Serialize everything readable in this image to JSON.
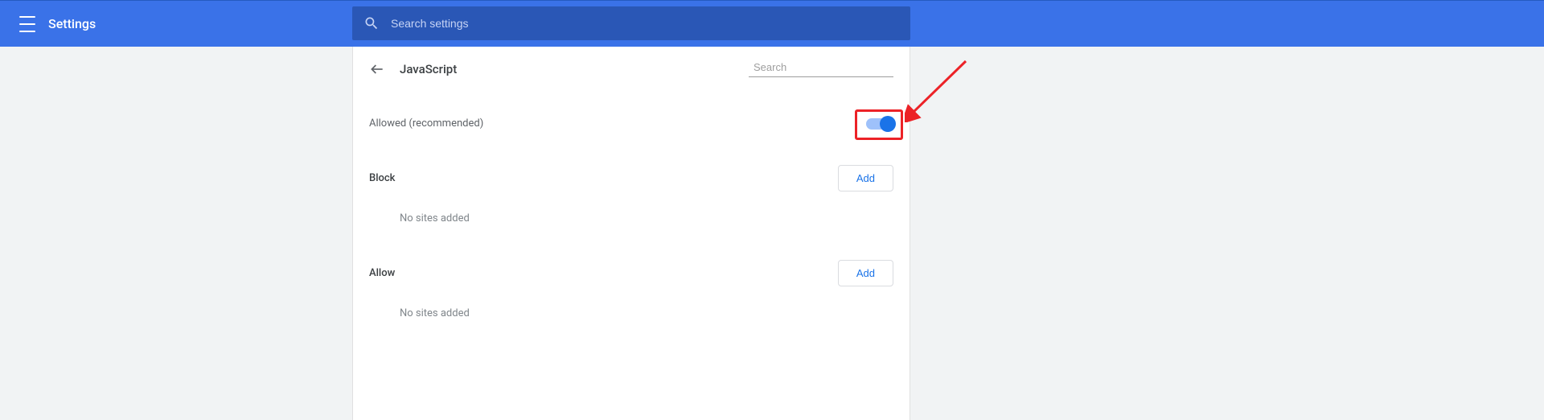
{
  "header": {
    "app_title": "Settings",
    "search_placeholder": "Search settings"
  },
  "panel": {
    "title": "JavaScript",
    "search_placeholder": "Search",
    "toggle_label": "Allowed (recommended)",
    "toggle_on": true,
    "sections": {
      "block": {
        "title": "Block",
        "empty_text": "No sites added",
        "add_label": "Add"
      },
      "allow": {
        "title": "Allow",
        "empty_text": "No sites added",
        "add_label": "Add"
      }
    }
  },
  "colors": {
    "primary_blue": "#3a72e8",
    "search_blue": "#2a57b6",
    "toggle_track": "#9ec1fa",
    "toggle_knob": "#1a73e8",
    "highlight_red": "#ec2227",
    "link_blue": "#1a73e8"
  }
}
